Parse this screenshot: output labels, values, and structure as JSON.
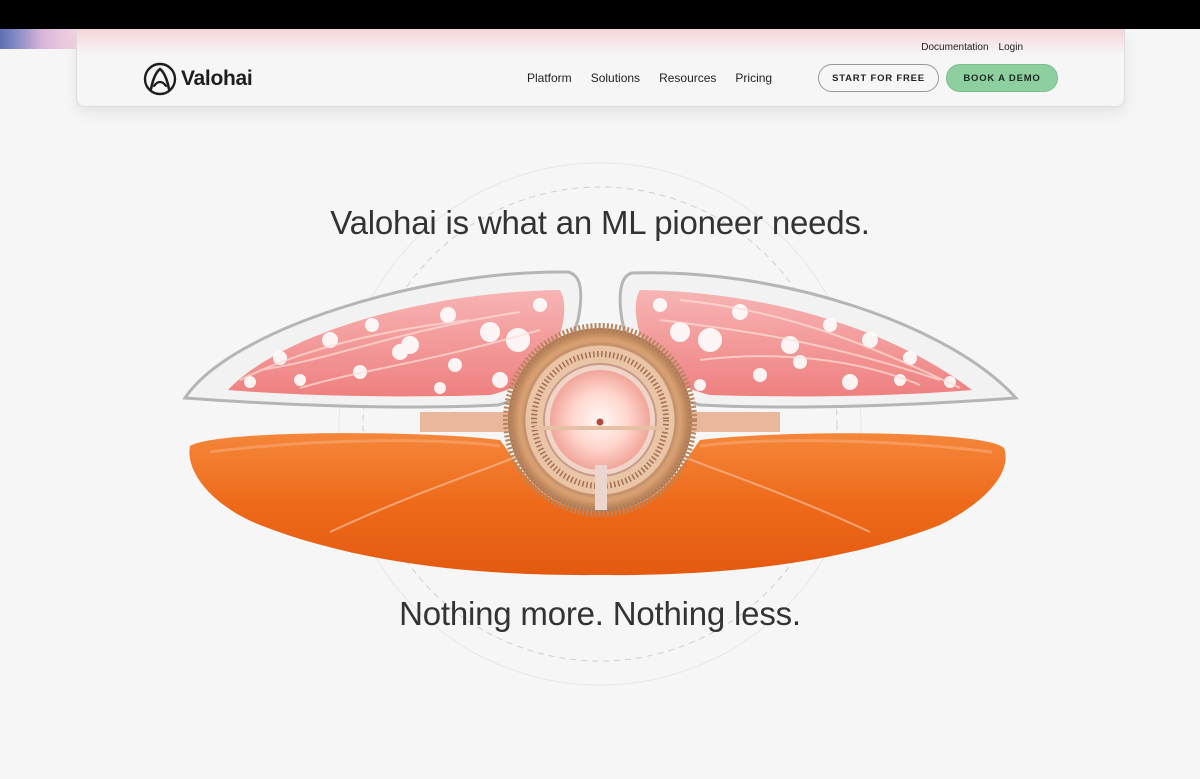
{
  "header": {
    "brand": "Valohai",
    "utility_links": [
      "Documentation",
      "Login"
    ],
    "menu": [
      "Platform",
      "Solutions",
      "Resources",
      "Pricing"
    ],
    "cta_outline": "START FOR FREE",
    "cta_primary": "BOOK A DEMO"
  },
  "hero": {
    "headline": "Valohai is what an ML pioneer needs.",
    "subline": "Nothing more. Nothing less."
  },
  "icons": {
    "logo": "valohai-logo-icon"
  },
  "colors": {
    "background": "#f6f6f6",
    "primary_button": "#8dcf9f",
    "orange": "#ee6a1a",
    "pink": "#f08b8b"
  }
}
